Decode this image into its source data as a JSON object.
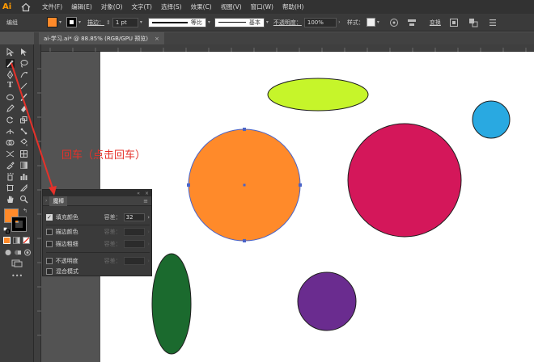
{
  "app": {
    "logo": "Ai",
    "menu": [
      "文件(F)",
      "编辑(E)",
      "对象(O)",
      "文字(T)",
      "选择(S)",
      "效果(C)",
      "视图(V)",
      "窗口(W)",
      "帮助(H)"
    ]
  },
  "control_bar": {
    "selection_label": "编组",
    "fill_color": "#ff8a2a",
    "stroke_label": "描边：",
    "stroke_value": "1 pt",
    "profile_label": "等比",
    "brush_label": "基本",
    "opacity_label": "不透明度：",
    "opacity_value": "100%",
    "style_label": "样式：",
    "transform_label": "变换"
  },
  "document": {
    "tab_title": "ai-学习.ai* @ 88.85% (RGB/GPU 预览)",
    "close": "×"
  },
  "annotation": {
    "text": "回车（点击回车）",
    "color": "#e5312a"
  },
  "magic_wand_panel": {
    "tab_title": "魔棒",
    "rows": [
      {
        "label": "填充颜色",
        "checked": true,
        "tolerance_label": "容差：",
        "tolerance_value": "32",
        "enabled": true
      },
      {
        "label": "描边颜色",
        "checked": false,
        "tolerance_label": "容差：",
        "tolerance_value": "",
        "enabled": false
      },
      {
        "label": "描边粗细",
        "checked": false,
        "tolerance_label": "容差：",
        "tolerance_value": "",
        "enabled": false
      },
      {
        "label": "不透明度",
        "checked": false,
        "tolerance_label": "容差：",
        "tolerance_value": "",
        "enabled": false
      },
      {
        "label": "混合模式",
        "checked": false,
        "tolerance_label": "",
        "tolerance_value": "",
        "enabled": false
      }
    ]
  },
  "toolbar": {
    "fill_color": "#ff8a2a",
    "stroke_color": "#000000"
  },
  "artwork": {
    "shapes": [
      {
        "name": "lime-ellipse",
        "color": "#c6f52a"
      },
      {
        "name": "blue-circle",
        "color": "#29a9e1"
      },
      {
        "name": "orange-circle",
        "color": "#ff8a2a",
        "selected": true
      },
      {
        "name": "crimson-circle",
        "color": "#d4175a"
      },
      {
        "name": "green-ellipse",
        "color": "#1b6a2e"
      },
      {
        "name": "purple-circle",
        "color": "#6a2c8f"
      }
    ]
  }
}
